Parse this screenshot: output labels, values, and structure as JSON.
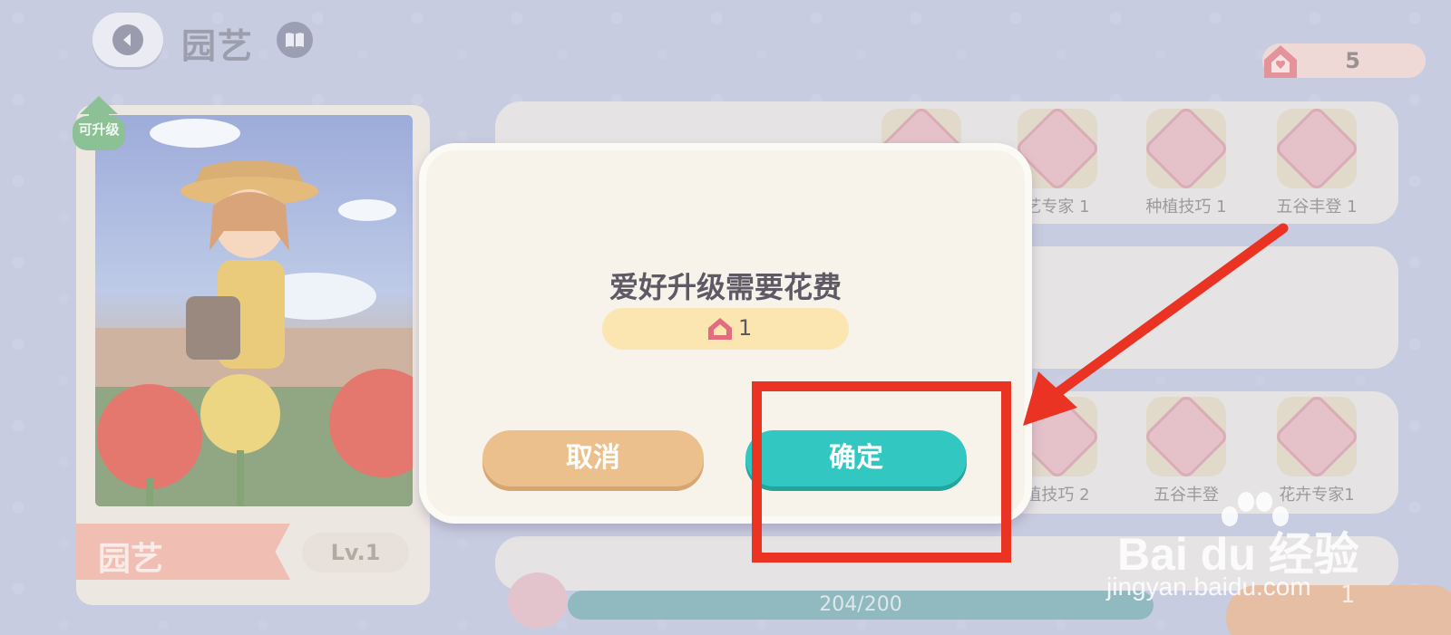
{
  "header": {
    "title": "园艺",
    "currency_count": "5"
  },
  "hobby_card": {
    "badge": "可升级",
    "name": "园艺",
    "level": "Lv.1"
  },
  "skills_row1": [
    "艺专家 1",
    "种植技巧 1",
    "五谷丰登 1"
  ],
  "skills_row3": [
    "植技巧 2",
    "五谷丰登",
    "花卉专家1"
  ],
  "progress": {
    "text": "204/200"
  },
  "bottom_button": {
    "count": "1"
  },
  "dialog": {
    "title": "爱好升级需要花费",
    "cost": "1",
    "cancel_label": "取消",
    "ok_label": "确定"
  },
  "watermark": {
    "main": "Bai du 经验",
    "sub": "jingyan.baidu.com"
  },
  "colors": {
    "ok_button": "#33c7c1",
    "cancel_button": "#ecc08c",
    "annotation_red": "#ea3323"
  }
}
